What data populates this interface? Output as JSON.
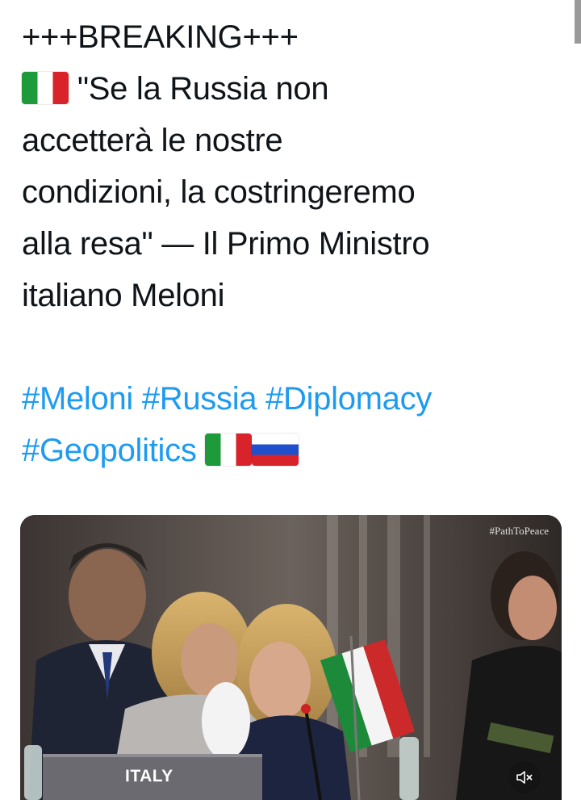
{
  "tweet": {
    "line1": "+++BREAKING+++",
    "flag_it_icon": "italy-flag-icon",
    "quote_line1": " \"Se la Russia non",
    "quote_line2": "accetterà le nostre",
    "quote_line3": "condizioni, la costringeremo",
    "quote_line4": "alla resa\" — Il Primo Ministro",
    "quote_line5": "italiano Meloni",
    "hashtags": [
      "#Meloni",
      "#Russia",
      "#Diplomacy",
      "#Geopolitics"
    ],
    "trailing_flag_icons": [
      "italy-flag-icon",
      "russia-flag-icon"
    ]
  },
  "media": {
    "watermark": "#PathToPeace",
    "placard": "ITALY",
    "mute_icon": "volume-mute-icon"
  },
  "colors": {
    "text": "#0f1419",
    "hashtag": "#1d9bf0"
  }
}
